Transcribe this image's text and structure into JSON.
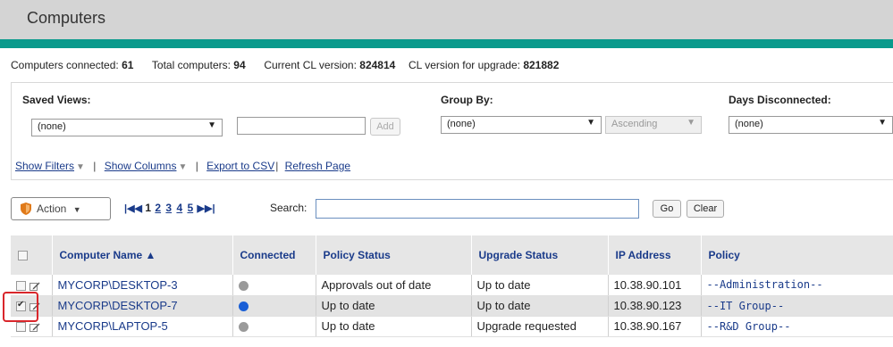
{
  "page": {
    "title": "Computers"
  },
  "stats": {
    "connected_label": "Computers connected:",
    "connected_value": "61",
    "total_label": "Total computers:",
    "total_value": "94",
    "cl_label": "Current CL version:",
    "cl_value": "824814",
    "upgrade_label": "CL version for upgrade:",
    "upgrade_value": "821882"
  },
  "filters": {
    "saved_views_label": "Saved Views:",
    "saved_views_value": "(none)",
    "view_name_value": "",
    "add_label": "Add",
    "group_by_label": "Group By:",
    "group_by_value": "(none)",
    "order_value": "Ascending",
    "days_disconnected_label": "Days Disconnected:",
    "days_disconnected_value": "(none)"
  },
  "links": {
    "show_filters": "Show Filters",
    "show_columns": "Show Columns",
    "export_csv": "Export to CSV",
    "refresh": "Refresh Page"
  },
  "toolbar": {
    "action_label": "Action",
    "pages": [
      "1",
      "2",
      "3",
      "4",
      "5"
    ],
    "search_label": "Search:",
    "search_value": "",
    "go_label": "Go",
    "clear_label": "Clear"
  },
  "table": {
    "columns": [
      "Computer Name ▲",
      "Connected",
      "Policy Status",
      "Upgrade Status",
      "IP Address",
      "Policy"
    ],
    "rows": [
      {
        "checked": false,
        "name": "MYCORP\\DESKTOP-3",
        "connected": "grey",
        "policy_status": "Approvals out of date",
        "upgrade_status": "Up to date",
        "ip": "10.38.90.101",
        "policy": "--Administration--"
      },
      {
        "checked": true,
        "name": "MYCORP\\DESKTOP-7",
        "connected": "blue",
        "policy_status": "Up to date",
        "upgrade_status": "Up to date",
        "ip": "10.38.90.123",
        "policy": "--IT Group--"
      },
      {
        "checked": false,
        "name": "MYCORP\\LAPTOP-5",
        "connected": "grey",
        "policy_status": "Up to date",
        "upgrade_status": "Upgrade requested",
        "ip": "10.38.90.167",
        "policy": "--R&D Group--"
      }
    ]
  },
  "colors": {
    "accent_teal": "#0a9a8c",
    "link_blue": "#1a3b8a",
    "connected_blue": "#1a5fd6",
    "disconnected_grey": "#9a9a9a",
    "highlight_red": "#d9262b"
  }
}
